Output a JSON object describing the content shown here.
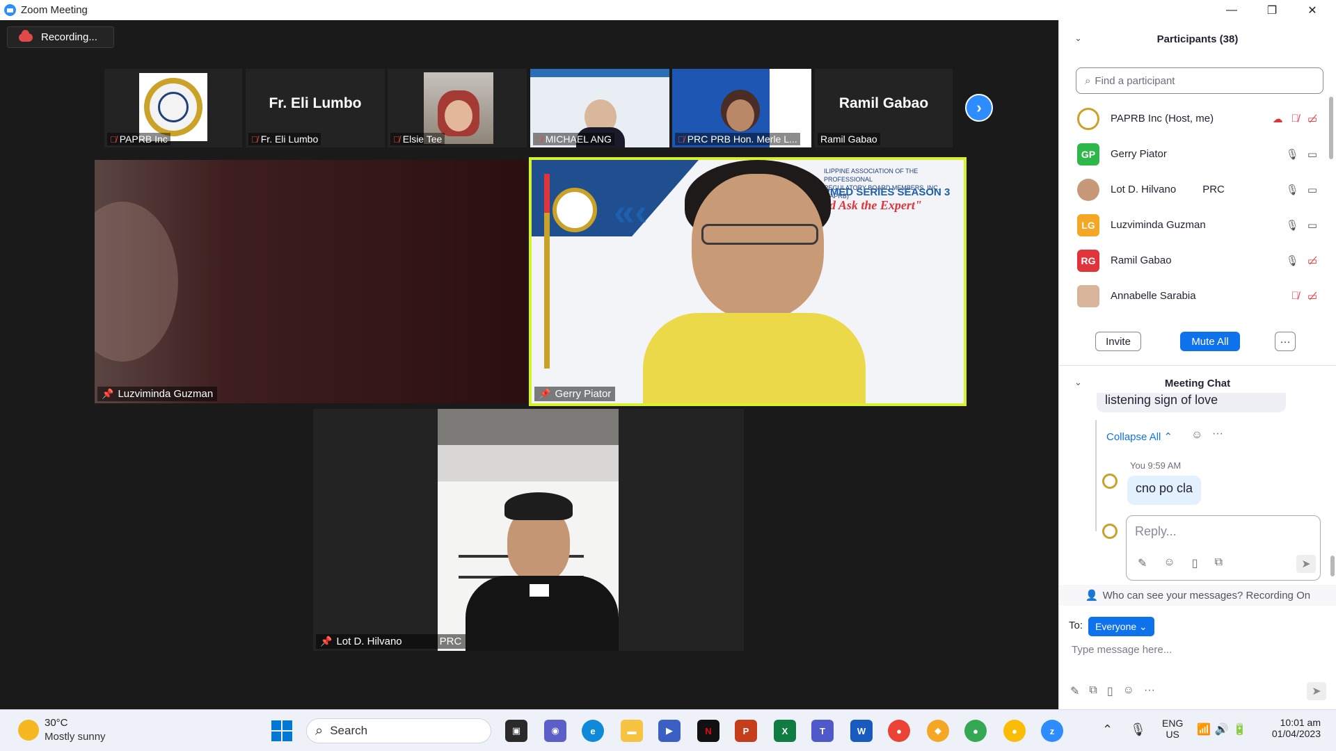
{
  "window": {
    "title": "Zoom Meeting",
    "minimize": "—",
    "restore": "❐",
    "close": "✕"
  },
  "recording": {
    "label": "Recording..."
  },
  "strip": [
    {
      "name": "PAPRB Inc",
      "muted": true
    },
    {
      "name": "Fr. Eli Lumbo",
      "muted": true,
      "big_name": "Fr. Eli Lumbo"
    },
    {
      "name": "Elsie Tee",
      "muted": true
    },
    {
      "name": "MICHAEL ANG",
      "muted": true
    },
    {
      "name": "PRC PRB Hon. Merle L...",
      "muted": true
    },
    {
      "name": "Ramil Gabao",
      "muted": false,
      "big_name": "Ramil Gabao"
    }
  ],
  "tiles": {
    "luzviminda": {
      "name": "Luzviminda Guzman"
    },
    "gerry": {
      "name": "Gerry Piator",
      "banner1": "ILIPPINE ASSOCIATION OF THE PROFESSIONAL",
      "banner2": "REGULATORY BOARD MEMBERS, INC. (PAPRB)",
      "banner3": "RMED SERIES SEASON 3",
      "banner4": "nd  Ask the Expert\""
    },
    "lot": {
      "name": "Lot D. Hilvano",
      "tag": "PRC"
    }
  },
  "participants": {
    "header": "Participants (38)",
    "search_placeholder": "Find a participant",
    "list": [
      {
        "name": "PAPRB Inc (Host, me)",
        "initials": "",
        "color": "#ffffff",
        "tag": ""
      },
      {
        "name": "Gerry Piator",
        "initials": "GP",
        "color": "#2eb84a",
        "tag": ""
      },
      {
        "name": "Lot D. Hilvano",
        "initials": "",
        "color": "#ffffff",
        "tag": "PRC"
      },
      {
        "name": "Luzviminda Guzman",
        "initials": "LG",
        "color": "#f5a623",
        "tag": ""
      },
      {
        "name": "Ramil Gabao",
        "initials": "RG",
        "color": "#e0343b",
        "tag": ""
      },
      {
        "name": "Annabelle Sarabia",
        "initials": "",
        "color": "#ffffff",
        "tag": ""
      }
    ],
    "invite": "Invite",
    "mute_all": "Mute All",
    "more": "···"
  },
  "chat": {
    "header": "Meeting Chat",
    "prev_message": "listening sign of love",
    "collapse": "Collapse All ⌃",
    "sender": "You 9:59 AM",
    "message": "cno po cla",
    "reply_placeholder": "Reply...",
    "who_can_see": "Who can see your messages? Recording On",
    "to_label": "To:",
    "to_value": "Everyone ⌄",
    "type_placeholder": "Type message here..."
  },
  "taskbar": {
    "weather_temp": "30°C",
    "weather_desc": "Mostly sunny",
    "search": "Search",
    "lang1": "ENG",
    "lang2": "US",
    "time": "10:01 am",
    "date": "01/04/2023"
  }
}
